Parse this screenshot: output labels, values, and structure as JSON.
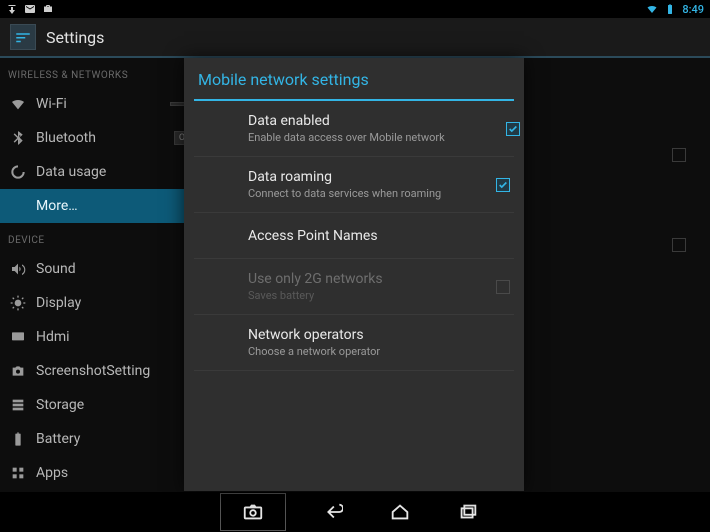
{
  "status": {
    "time": "8:49"
  },
  "appbar": {
    "title": "Settings"
  },
  "sidebar": {
    "cat1": "WIRELESS & NETWORKS",
    "items1": [
      {
        "label": "Wi-Fi",
        "toggle": ""
      },
      {
        "label": "Bluetooth",
        "toggle": "OFF"
      },
      {
        "label": "Data usage"
      },
      {
        "label": "More…"
      }
    ],
    "cat2": "DEVICE",
    "items2": [
      {
        "label": "Sound"
      },
      {
        "label": "Display"
      },
      {
        "label": "Hdmi"
      },
      {
        "label": "ScreenshotSetting"
      },
      {
        "label": "Storage"
      },
      {
        "label": "Battery"
      },
      {
        "label": "Apps"
      }
    ]
  },
  "dialog": {
    "title": "Mobile network settings",
    "items": [
      {
        "primary": "Data enabled",
        "secondary": "Enable data access over Mobile network",
        "checked": true
      },
      {
        "primary": "Data roaming",
        "secondary": "Connect to data services when roaming",
        "checked": true
      },
      {
        "primary": "Access Point Names"
      },
      {
        "primary": "Use only 2G networks",
        "secondary": "Saves battery",
        "checked": false,
        "disabled": true
      },
      {
        "primary": "Network operators",
        "secondary": "Choose a network operator"
      }
    ]
  }
}
